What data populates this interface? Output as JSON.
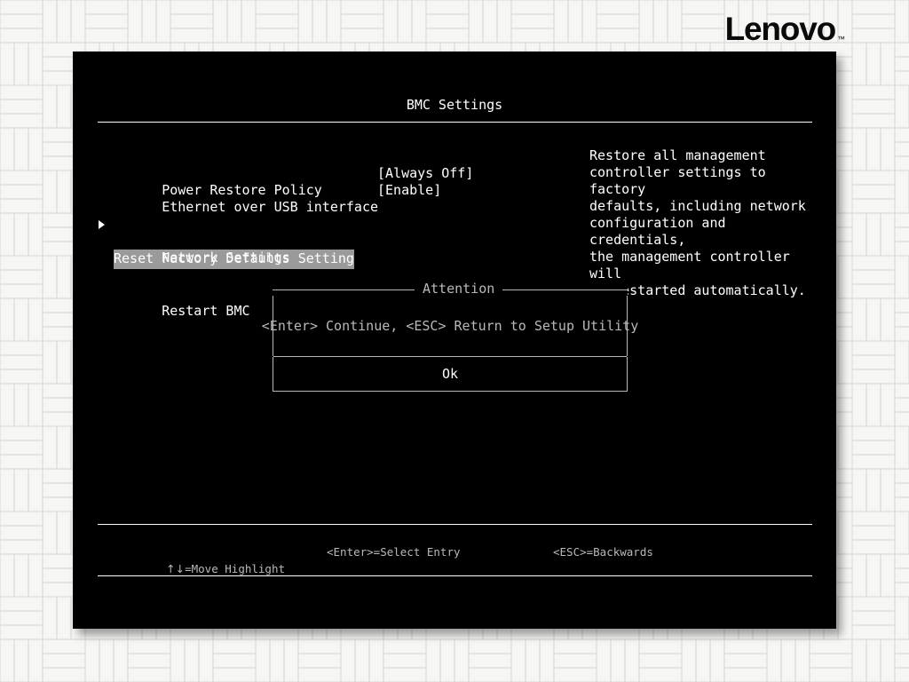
{
  "brand": {
    "name": "Lenovo",
    "trademark": "™"
  },
  "screen": {
    "title": "BMC Settings"
  },
  "settings": {
    "rows": [
      {
        "label": "Power Restore Policy",
        "value": "[Always Off]"
      },
      {
        "label": "Ethernet over USB interface",
        "value": "[Enable]"
      }
    ],
    "submenu": {
      "label": "Network Settings",
      "marker": "right-triangle"
    },
    "selected_item": "Reset Factory Defaults Setting",
    "action_item": "Restart BMC"
  },
  "help": {
    "text": "Restore all management\ncontroller settings to factory\ndefaults, including network\nconfiguration and credentials,\nthe management controller will\nbe restarted automatically."
  },
  "dialog": {
    "title": "Attention",
    "message": "<Enter> Continue, <ESC> Return to Setup Utility",
    "ok_label": "Ok"
  },
  "footer": {
    "hints": [
      {
        "keys": "↑↓",
        "text": "=Move Highlight"
      },
      {
        "keys": "",
        "text": "<Enter>=Select Entry"
      },
      {
        "keys": "",
        "text": "<ESC>=Backwards"
      }
    ],
    "move_hint_keys": "↑↓",
    "move_hint_text": "=Move Highlight",
    "enter_hint_text": "<Enter>=Select Entry",
    "esc_hint_text": "<ESC>=Backwards"
  },
  "colors": {
    "panel_background": "#000000",
    "text": "#ffffff",
    "dim_text": "#b9b9b9",
    "highlight_background": "#9a9a9a",
    "wallpaper": "#f6f6f4",
    "brand_text": "#0a0a0a"
  }
}
